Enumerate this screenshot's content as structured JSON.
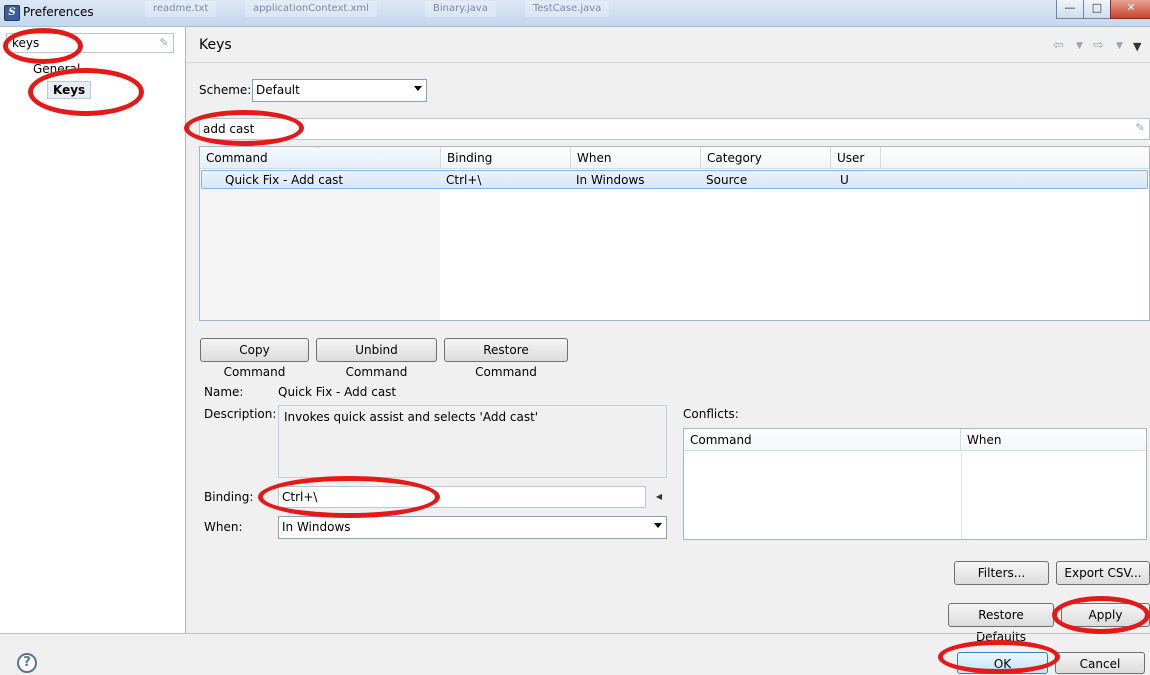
{
  "window": {
    "title": "Preferences",
    "bg_tabs": [
      "readme.txt",
      "applicationContext.xml",
      "Binary.java",
      "TestCase.java"
    ]
  },
  "left": {
    "filter_value": "keys",
    "tree": {
      "general": "General",
      "keys": "Keys"
    }
  },
  "page": {
    "heading": "Keys"
  },
  "scheme": {
    "label": "Scheme:",
    "value": "Default"
  },
  "search": {
    "value": "add cast"
  },
  "table": {
    "headers": [
      "Command",
      "Binding",
      "When",
      "Category",
      "User"
    ],
    "rows": [
      {
        "command": "Quick Fix - Add cast",
        "binding": "Ctrl+\\",
        "when": "In Windows",
        "category": "Source",
        "user": "U"
      }
    ]
  },
  "actions": {
    "copy": "Copy Command",
    "unbind": "Unbind Command",
    "restore": "Restore Command"
  },
  "details": {
    "name_label": "Name:",
    "name_value": "Quick Fix - Add cast",
    "desc_label": "Description:",
    "desc_value": "Invokes quick assist and selects 'Add cast'",
    "binding_label": "Binding:",
    "binding_value": "Ctrl+\\",
    "when_label": "When:",
    "when_value": "In Windows"
  },
  "conflicts": {
    "label": "Conflicts:",
    "headers": [
      "Command",
      "When"
    ]
  },
  "buttons": {
    "filters": "Filters...",
    "export_csv": "Export CSV...",
    "restore_defaults": "Restore Defaults",
    "apply": "Apply",
    "ok": "OK",
    "cancel": "Cancel"
  },
  "colors": {
    "annotation": "#e61919",
    "selection": "#d8e7f7"
  },
  "icons": [
    "app-icon",
    "eraser-icon",
    "back-arrow-icon",
    "forward-arrow-icon",
    "chevron-down-icon",
    "view-menu-icon",
    "help-icon",
    "sort-ascending-icon"
  ]
}
